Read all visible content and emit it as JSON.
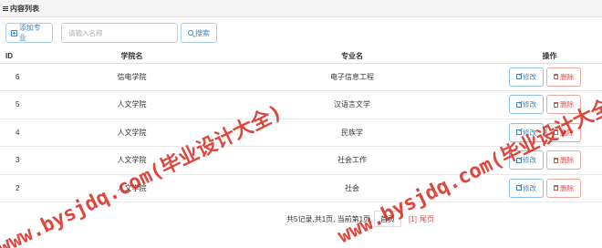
{
  "panel": {
    "title": "内容列表",
    "icon": "list-icon"
  },
  "toolbar": {
    "add_label": "添加专业",
    "add_icon": "plus-square-icon",
    "search_placeholder": "请输入名称",
    "search_value": "",
    "search_label": "搜索",
    "search_icon": "search-icon"
  },
  "table": {
    "headers": {
      "id": "ID",
      "college": "学院名",
      "major": "专业名",
      "ops": "操作"
    },
    "rows": [
      {
        "id": "6",
        "college": "信电学院",
        "major": "电子信息工程",
        "edit": "修改",
        "del": "删除"
      },
      {
        "id": "5",
        "college": "人文学院",
        "major": "汉语言文学",
        "edit": "修改",
        "del": "删除"
      },
      {
        "id": "4",
        "college": "人文学院",
        "major": "民族学",
        "edit": "修改",
        "del": "删除"
      },
      {
        "id": "3",
        "college": "人文学院",
        "major": "社会工作",
        "edit": "修改",
        "del": "删除"
      },
      {
        "id": "2",
        "college": "人文学院",
        "major": "社会",
        "edit": "修改",
        "del": "删除"
      }
    ]
  },
  "pagination": {
    "summary": "共5记录,共1页, 当前第1页",
    "first": "首页",
    "current": "[1]",
    "last": "尾页"
  },
  "watermark": {
    "text": "www.bysjdq.com(毕业设计大全)",
    "color": "#d71e14"
  }
}
